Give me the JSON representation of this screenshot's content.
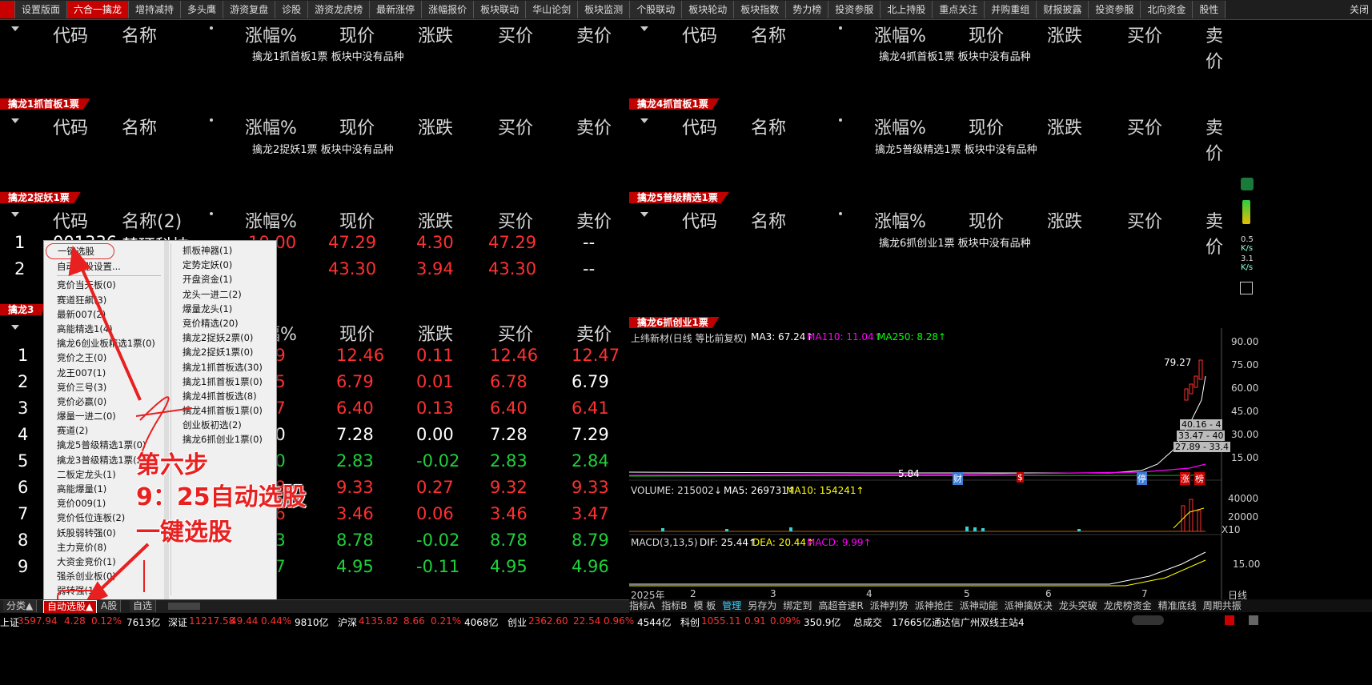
{
  "top_tabs": [
    "设置版面",
    "六合一擒龙",
    "增持减持",
    "多头鹰",
    "游资复盘",
    "诊股",
    "游资龙虎榜",
    "最新涨停",
    "涨幅报价",
    "板块联动",
    "华山论剑",
    "板块监测",
    "个股联动",
    "板块轮动",
    "板块指数",
    "势力榜",
    "投资参服",
    "北上持股",
    "重点关注",
    "并购重组",
    "财报披露",
    "投资参服",
    "北向资金",
    "股性"
  ],
  "close_label": "关闭",
  "columns": [
    "代码",
    "名称",
    "涨幅%",
    "现价",
    "涨跌",
    "买价",
    "卖价"
  ],
  "columns_alt_name": "名称(2)",
  "panels": {
    "p1": {
      "ribbon": "擒龙1抓首板1票",
      "empty": "擒龙1抓首板1票 板块中没有品种"
    },
    "p2": {
      "ribbon": "擒龙2捉妖1票",
      "empty": "擒龙2捉妖1票 板块中没有品种"
    },
    "p3": {
      "ribbon": "擒龙3"
    },
    "p4": {
      "ribbon": "擒龙4抓首板1票",
      "empty": "擒龙4抓首板1票 板块中没有品种"
    },
    "p5": {
      "ribbon": "擒龙5普级精选1票",
      "empty": "擒龙5普级精选1票 板块中没有品种"
    },
    "p6": {
      "ribbon": "擒龙6抓创业1票",
      "empty": "擒龙6抓创业1票 板块中没有品种"
    }
  },
  "p2_rows": [
    {
      "idx": "1",
      "code": "001336",
      "name": "楚环科技",
      "chg": "10.00",
      "price": "47.29",
      "diff": "4.30",
      "bid": "47.29",
      "ask": "--"
    },
    {
      "idx": "2",
      "code": "",
      "name": "",
      "chg": ".01",
      "price": "43.30",
      "diff": "3.94",
      "bid": "43.30",
      "ask": "--"
    }
  ],
  "p3_rows": [
    {
      "idx": "1",
      "chg": "89",
      "price": "12.46",
      "diff": "0.11",
      "bid": "12.46",
      "ask": "12.47",
      "c": [
        "red",
        "red",
        "red",
        "red",
        "red"
      ]
    },
    {
      "idx": "2",
      "chg": "15",
      "price": "6.79",
      "diff": "0.01",
      "bid": "6.78",
      "ask": "6.79",
      "c": [
        "red",
        "red",
        "red",
        "wht",
        "red"
      ]
    },
    {
      "idx": "3",
      "chg": "07",
      "price": "6.40",
      "diff": "0.13",
      "bid": "6.40",
      "ask": "6.41",
      "c": [
        "red",
        "red",
        "red",
        "red",
        "red"
      ]
    },
    {
      "idx": "4",
      "chg": "00",
      "price": "7.28",
      "diff": "0.00",
      "bid": "7.28",
      "ask": "7.29",
      "c": [
        "wht",
        "wht",
        "wht",
        "wht",
        "red"
      ]
    },
    {
      "idx": "5",
      "chg": "70",
      "price": "2.83",
      "diff": "-0.02",
      "bid": "2.83",
      "ask": "2.84",
      "c": [
        "grn",
        "grn",
        "grn",
        "grn",
        "grn"
      ]
    },
    {
      "idx": "6",
      "chg": "98",
      "price": "9.33",
      "diff": "0.27",
      "bid": "9.32",
      "ask": "9.33",
      "c": [
        "red",
        "red",
        "red",
        "red",
        "red"
      ]
    },
    {
      "idx": "7",
      "chg": "76",
      "price": "3.46",
      "diff": "0.06",
      "bid": "3.46",
      "ask": "3.47",
      "c": [
        "red",
        "red",
        "red",
        "red",
        "red"
      ]
    },
    {
      "idx": "8",
      "chg": "23",
      "price": "8.78",
      "diff": "-0.02",
      "bid": "8.78",
      "ask": "8.79",
      "c": [
        "grn",
        "grn",
        "grn",
        "grn",
        "grn"
      ]
    },
    {
      "idx": "9",
      "chg": "17",
      "price": "4.95",
      "diff": "-0.11",
      "bid": "4.95",
      "ask": "4.96",
      "c": [
        "grn",
        "grn",
        "grn",
        "grn",
        "grn"
      ]
    }
  ],
  "menu": {
    "col1": [
      "一键选股",
      "自动选股设置...",
      "竞价当天板(0)",
      "赛道狂飙(3)",
      "最新007(2)",
      "高能精选1(4)",
      "擒龙6创业板精选1票(0)",
      "竞价之王(0)",
      "龙王007(1)",
      "竞价三号(3)",
      "竞价必赢(0)",
      "爆量一进二(0)",
      "赛道(2)",
      "擒龙5普级精选1票(0)",
      "擒龙3普级精选1票(2)",
      "二板定龙头(1)",
      "高能爆量(1)",
      "竞价009(1)",
      "竞价低位连板(2)",
      "妖股弱转强(0)",
      "主力竞价(8)",
      "大资金竞价(1)",
      "强杀创业板(0)",
      "弱转强(1)"
    ],
    "col2": [
      "抓板神器(1)",
      "定势定妖(0)",
      "开盘资金(1)",
      "龙头一进二(2)",
      "爆量龙头(1)",
      "竞价精选(20)",
      "擒龙2捉妖2票(0)",
      "擒龙2捉妖1票(0)",
      "擒龙1抓首板选(30)",
      "擒龙1抓首板1票(0)",
      "擒龙4抓首板选(8)",
      "擒龙4抓首板1票(0)",
      "创业板初选(2)",
      "擒龙6抓创业1票(0)"
    ]
  },
  "annotation": {
    "line1": "第六步",
    "line2": "9：25自动选股",
    "line3": "一键选股"
  },
  "chart": {
    "title": "上纬新材(日线 等比前复权)",
    "ma3": "MA3: 67.24↑",
    "ma110": "MA110: 11.04↑",
    "ma250": "MA250: 8.28↑",
    "high_label": "79.27",
    "low_label": "5.84",
    "price_ticks": [
      "90.00",
      "75.00",
      "60.00",
      "45.00",
      "30.00",
      "15.00"
    ],
    "price_boxes": [
      "40.16 - 4",
      "33.47 - 40",
      "27.89 - 33.4"
    ],
    "markers": [
      "财",
      "$",
      "停",
      "涨",
      "榜"
    ],
    "vol_legend": "VOLUME: 215002↓",
    "vol_ma5": "MA5: 269731↑",
    "vol_ma10": "MA10: 154241↑",
    "vol_ticks": [
      "40000",
      "20000",
      "X10"
    ],
    "macd_legend": "MACD(3,13,5)",
    "dif": "DIF: 25.44↑",
    "dea": "DEA: 20.44↑",
    "macd": "MACD: 9.99↑",
    "macd_tick": "15.00",
    "x_labels": [
      "2025年",
      "2",
      "3",
      "4",
      "5",
      "6",
      "7"
    ],
    "x_unit": "日线",
    "colors": {
      "ma3": "#ffffff",
      "ma110": "#ff00ff",
      "ma250": "#00ff00",
      "dea": "#ffff00"
    }
  },
  "side_widgets": {
    "speed1": "0.5",
    "unit1": "K/s",
    "speed2": "3.1",
    "unit2": "K/s"
  },
  "bottom_tabs": [
    "分类▲",
    "自动选股▲",
    "A股",
    "自选"
  ],
  "chart_toolbar": [
    "指标A",
    "指标B",
    "模 板",
    "管理",
    "另存为",
    "绑定到",
    "高超音速R",
    "派神判势",
    "派神抢庄",
    "派神动能",
    "派神擒妖决",
    "龙头突破",
    "龙虎榜资金",
    "精准底线",
    "周期共振"
  ],
  "status": {
    "sh_label": "上证",
    "sh_val": "3597.94",
    "sh_chg": "4.28",
    "sh_pct": "0.12%",
    "sh_amt": "7613亿",
    "sz_label": "深证",
    "sz_val": "11217.58",
    "sz_chg": "49.44",
    "sz_pct": "0.44%",
    "sz_amt": "9810亿",
    "hs_label": "沪深",
    "hs_val": "4135.82",
    "hs_chg": "8.66",
    "hs_pct": "0.21%",
    "hs_amt": "4068亿",
    "cy_label": "创业",
    "cy_val": "2362.60",
    "cy_chg": "22.54",
    "cy_pct": "0.96%",
    "cy_amt": "4544亿",
    "kc_label": "科创",
    "kc_val": "1055.11",
    "kc_chg": "0.91",
    "kc_pct": "0.09%",
    "kc_amt": "350.9亿",
    "total_label": "总成交",
    "total_val": "17665亿",
    "server": "通达信广州双线主站4"
  }
}
